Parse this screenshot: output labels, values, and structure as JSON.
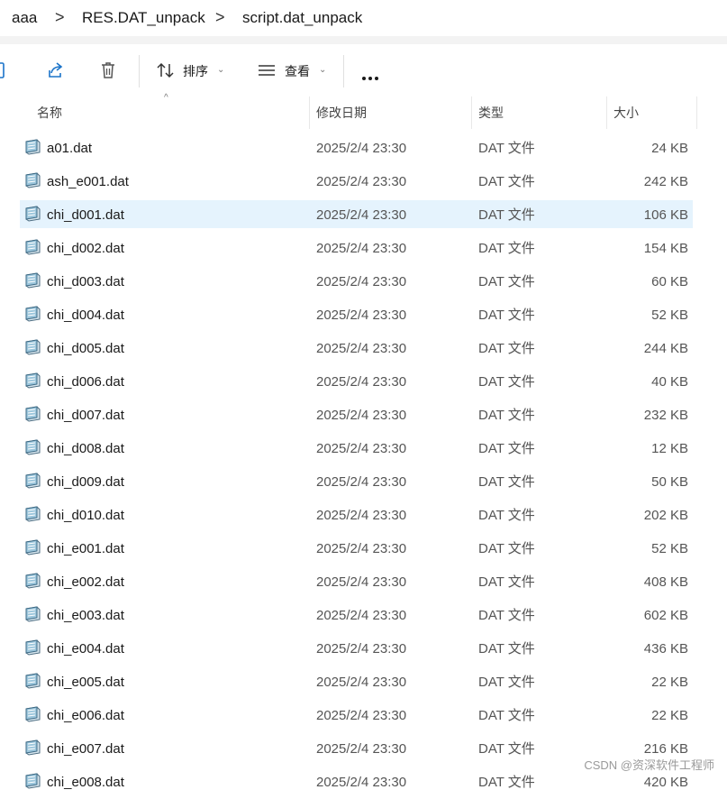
{
  "breadcrumb": {
    "items": [
      "aaa",
      "RES.DAT_unpack",
      "script.dat_unpack"
    ],
    "separator": ">"
  },
  "toolbar": {
    "sort_label": "排序",
    "view_label": "查看",
    "icons": [
      "cut-icon",
      "share-icon",
      "delete-icon",
      "sort-icon",
      "view-icon",
      "more-icon"
    ]
  },
  "columns": {
    "name": "名称",
    "date": "修改日期",
    "type": "类型",
    "size": "大小"
  },
  "files": [
    {
      "name": "a01.dat",
      "date": "2025/2/4 23:30",
      "type": "DAT 文件",
      "size": "24 KB"
    },
    {
      "name": "ash_e001.dat",
      "date": "2025/2/4 23:30",
      "type": "DAT 文件",
      "size": "242 KB"
    },
    {
      "name": "chi_d001.dat",
      "date": "2025/2/4 23:30",
      "type": "DAT 文件",
      "size": "106 KB"
    },
    {
      "name": "chi_d002.dat",
      "date": "2025/2/4 23:30",
      "type": "DAT 文件",
      "size": "154 KB"
    },
    {
      "name": "chi_d003.dat",
      "date": "2025/2/4 23:30",
      "type": "DAT 文件",
      "size": "60 KB"
    },
    {
      "name": "chi_d004.dat",
      "date": "2025/2/4 23:30",
      "type": "DAT 文件",
      "size": "52 KB"
    },
    {
      "name": "chi_d005.dat",
      "date": "2025/2/4 23:30",
      "type": "DAT 文件",
      "size": "244 KB"
    },
    {
      "name": "chi_d006.dat",
      "date": "2025/2/4 23:30",
      "type": "DAT 文件",
      "size": "40 KB"
    },
    {
      "name": "chi_d007.dat",
      "date": "2025/2/4 23:30",
      "type": "DAT 文件",
      "size": "232 KB"
    },
    {
      "name": "chi_d008.dat",
      "date": "2025/2/4 23:30",
      "type": "DAT 文件",
      "size": "12 KB"
    },
    {
      "name": "chi_d009.dat",
      "date": "2025/2/4 23:30",
      "type": "DAT 文件",
      "size": "50 KB"
    },
    {
      "name": "chi_d010.dat",
      "date": "2025/2/4 23:30",
      "type": "DAT 文件",
      "size": "202 KB"
    },
    {
      "name": "chi_e001.dat",
      "date": "2025/2/4 23:30",
      "type": "DAT 文件",
      "size": "52 KB"
    },
    {
      "name": "chi_e002.dat",
      "date": "2025/2/4 23:30",
      "type": "DAT 文件",
      "size": "408 KB"
    },
    {
      "name": "chi_e003.dat",
      "date": "2025/2/4 23:30",
      "type": "DAT 文件",
      "size": "602 KB"
    },
    {
      "name": "chi_e004.dat",
      "date": "2025/2/4 23:30",
      "type": "DAT 文件",
      "size": "436 KB"
    },
    {
      "name": "chi_e005.dat",
      "date": "2025/2/4 23:30",
      "type": "DAT 文件",
      "size": "22 KB"
    },
    {
      "name": "chi_e006.dat",
      "date": "2025/2/4 23:30",
      "type": "DAT 文件",
      "size": "22 KB"
    },
    {
      "name": "chi_e007.dat",
      "date": "2025/2/4 23:30",
      "type": "DAT 文件",
      "size": "216 KB"
    },
    {
      "name": "chi_e008.dat",
      "date": "2025/2/4 23:30",
      "type": "DAT 文件",
      "size": "420 KB"
    }
  ],
  "selected_index": 2,
  "watermark": "CSDN @资深软件工程师",
  "colors": {
    "selection": "#e5f3fd",
    "text": "#1a1a1a",
    "muted": "#555555"
  }
}
